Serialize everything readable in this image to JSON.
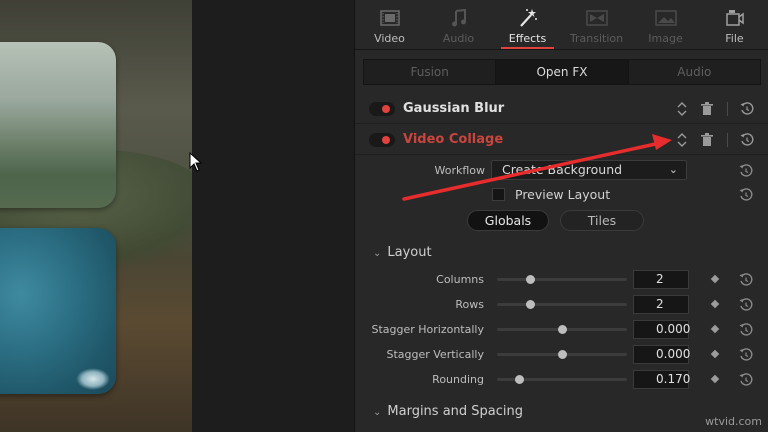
{
  "inspector": {
    "tabs": [
      {
        "label": "Video",
        "icon": "film-icon",
        "active": false
      },
      {
        "label": "Audio",
        "icon": "music-note-icon",
        "active": false
      },
      {
        "label": "Effects",
        "icon": "magic-wand-icon",
        "active": true
      },
      {
        "label": "Transition",
        "icon": "transition-icon",
        "active": false
      },
      {
        "label": "Image",
        "icon": "image-icon",
        "active": false
      },
      {
        "label": "File",
        "icon": "file-icon",
        "active": false
      }
    ],
    "subtabs": [
      {
        "label": "Fusion",
        "active": false
      },
      {
        "label": "Open FX",
        "active": true
      },
      {
        "label": "Audio",
        "active": false
      }
    ],
    "effects": [
      {
        "name": "Gaussian Blur",
        "enabled": true
      },
      {
        "name": "Video Collage",
        "enabled": true,
        "highlighted": true
      }
    ],
    "workflow": {
      "label": "Workflow",
      "value": "Create Background"
    },
    "preview_layout": {
      "label": "Preview Layout",
      "checked": false
    },
    "mode_pills": [
      {
        "label": "Globals",
        "active": true
      },
      {
        "label": "Tiles",
        "active": false
      }
    ],
    "layout_section": {
      "title": "Layout",
      "params": [
        {
          "label": "Columns",
          "value": "2",
          "slider": 0.25
        },
        {
          "label": "Rows",
          "value": "2",
          "slider": 0.25
        },
        {
          "label": "Stagger Horizontally",
          "value": "0.000",
          "slider": 0.5
        },
        {
          "label": "Stagger Vertically",
          "value": "0.000",
          "slider": 0.5
        },
        {
          "label": "Rounding",
          "value": "0.170",
          "slider": 0.17
        }
      ]
    },
    "margins_section": {
      "title": "Margins and Spacing"
    }
  },
  "watermark": "wtvid.com",
  "colors": {
    "accent": "#e0433e",
    "panel": "#282828",
    "highlight_name": "#c9453e"
  }
}
